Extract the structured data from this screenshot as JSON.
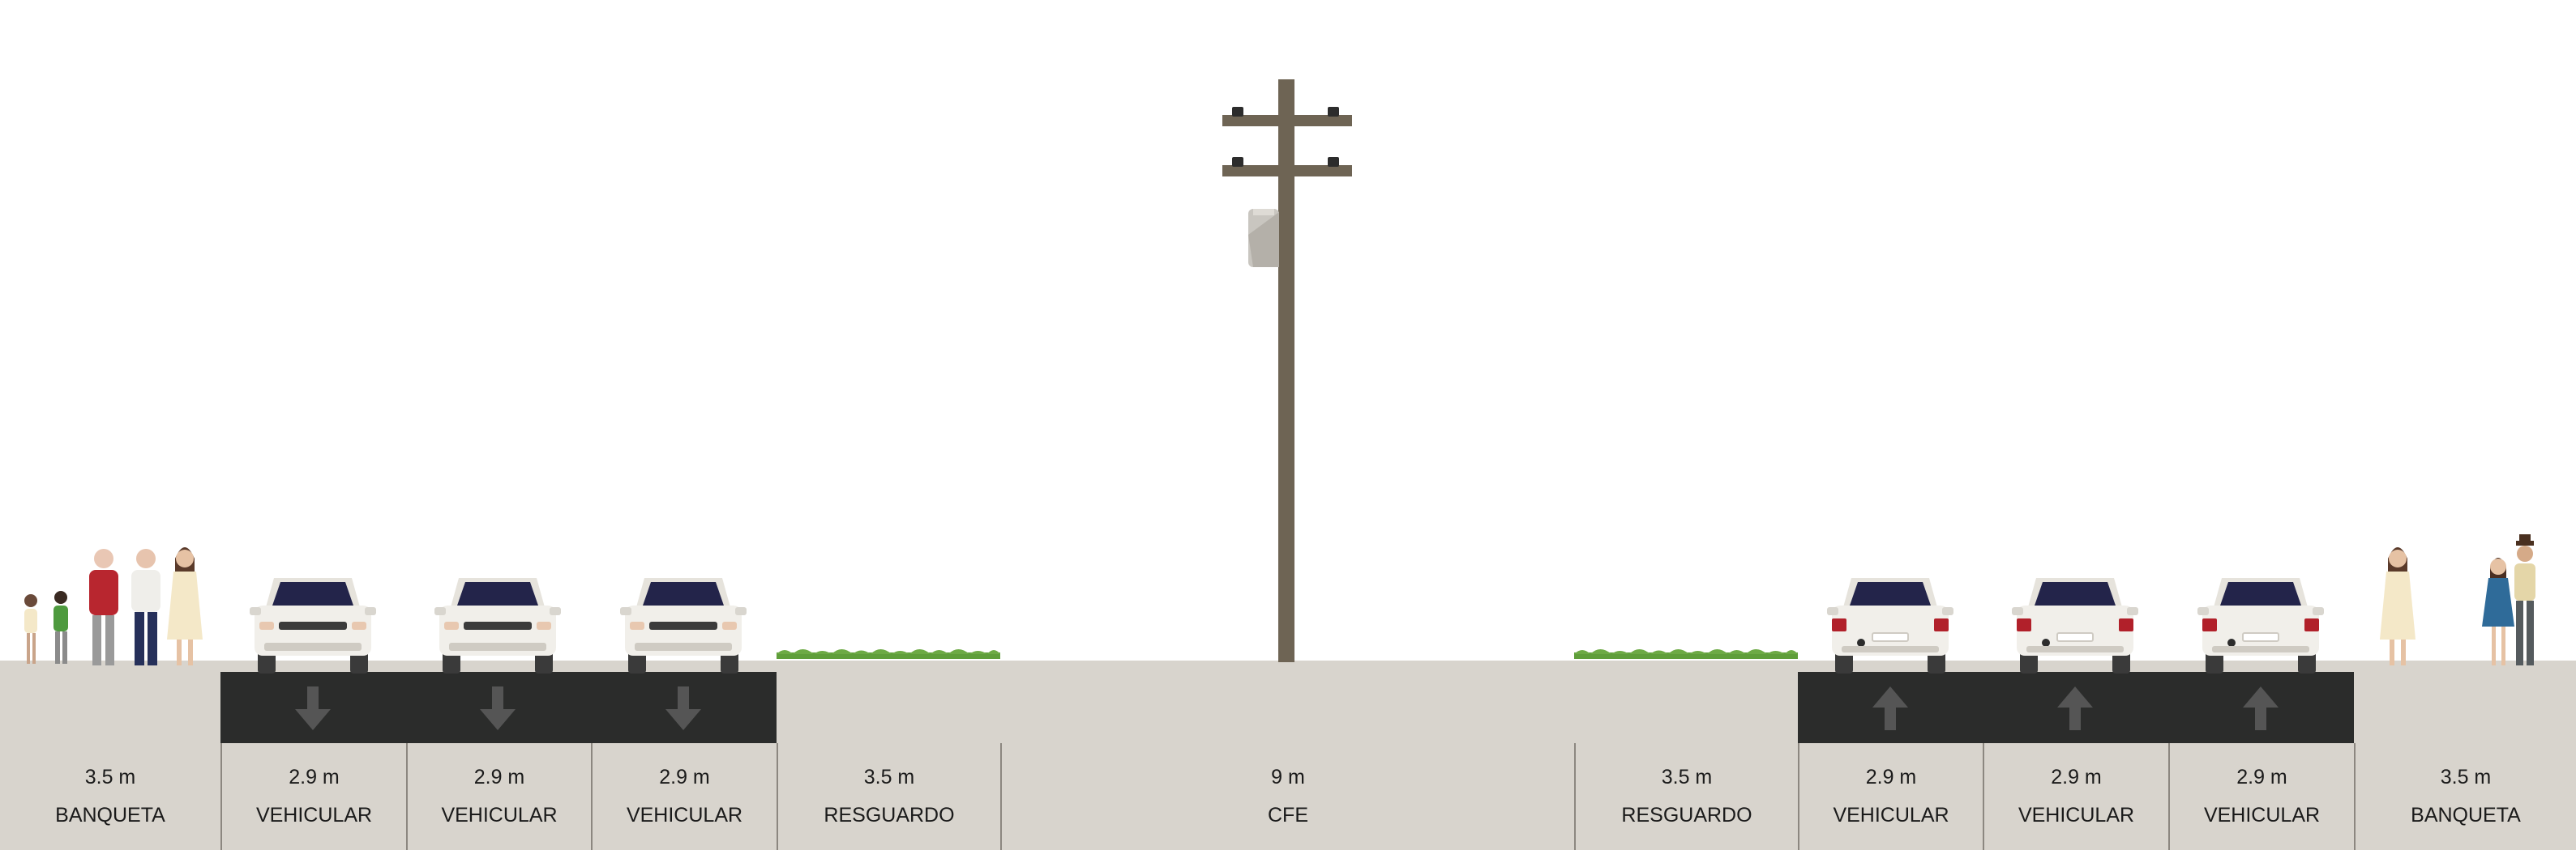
{
  "segments": [
    {
      "width": "3.5 m",
      "name": "BANQUETA",
      "type": "sidewalk",
      "direction": ""
    },
    {
      "width": "2.9 m",
      "name": "VEHICULAR",
      "type": "drive-lane",
      "direction": "down"
    },
    {
      "width": "2.9 m",
      "name": "VEHICULAR",
      "type": "drive-lane",
      "direction": "down"
    },
    {
      "width": "2.9 m",
      "name": "VEHICULAR",
      "type": "drive-lane",
      "direction": "down"
    },
    {
      "width": "3.5 m",
      "name": "RESGUARDO",
      "type": "buffer",
      "direction": ""
    },
    {
      "width": "9 m",
      "name": "CFE",
      "type": "utility",
      "direction": ""
    },
    {
      "width": "3.5 m",
      "name": "RESGUARDO",
      "type": "buffer",
      "direction": ""
    },
    {
      "width": "2.9 m",
      "name": "VEHICULAR",
      "type": "drive-lane",
      "direction": "up"
    },
    {
      "width": "2.9 m",
      "name": "VEHICULAR",
      "type": "drive-lane",
      "direction": "up"
    },
    {
      "width": "2.9 m",
      "name": "VEHICULAR",
      "type": "drive-lane",
      "direction": "up"
    },
    {
      "width": "3.5 m",
      "name": "BANQUETA",
      "type": "sidewalk",
      "direction": ""
    }
  ],
  "colors": {
    "ground": "#d8d4cd",
    "asphalt": "#2b2c2b",
    "arrow": "#555555",
    "grass": "#5f9e3a",
    "pole": "#6e6454",
    "divider": "#8c8780"
  }
}
